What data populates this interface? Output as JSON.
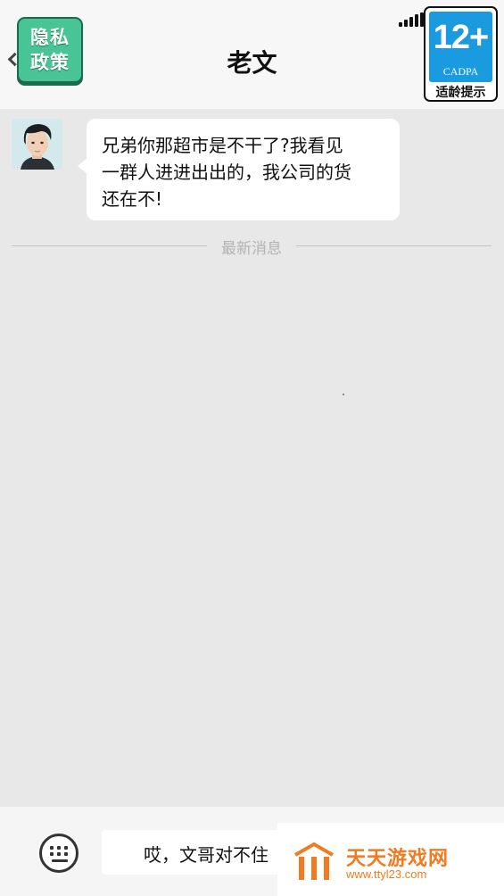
{
  "header": {
    "title": "老文",
    "privacy_button": {
      "line1": "隐私",
      "line2": "政策"
    },
    "age_rating": {
      "number": "12+",
      "org": "CADPA",
      "label": "适龄提示",
      "color": "#1a9adf"
    }
  },
  "messages": [
    {
      "sender": "老文",
      "avatar": "male-avatar",
      "text_lines": [
        "兄弟你那超市是不干了?我看见",
        "一群人进进出出的，我公司的货",
        "还在不!"
      ]
    }
  ],
  "divider": {
    "label": "最新消息"
  },
  "composer": {
    "keyboard_icon": "keyboard-icon",
    "reply_text": "哎，文哥对不住"
  },
  "watermark": {
    "name": "天天游戏网",
    "url": "www.ttyl23.com",
    "color": "#f07b20"
  }
}
